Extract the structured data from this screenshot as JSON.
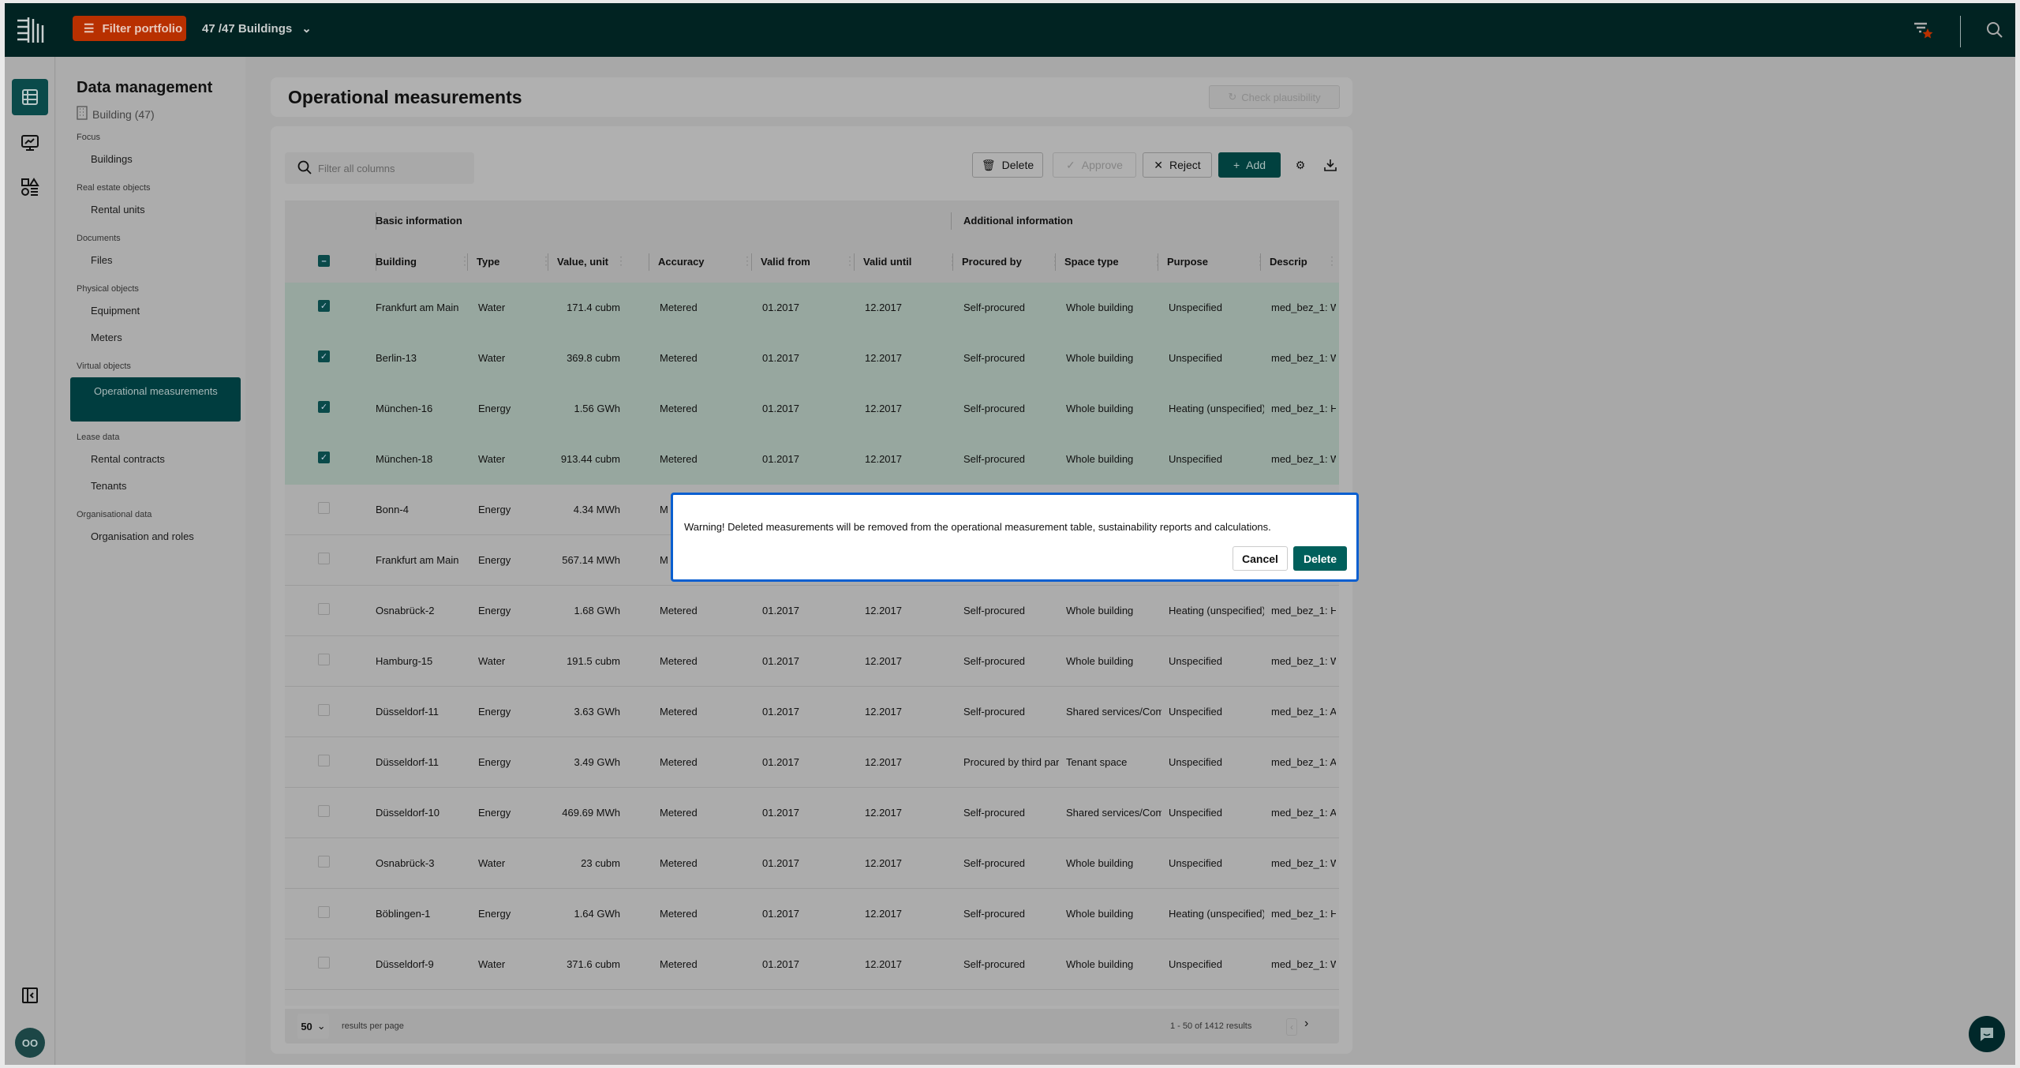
{
  "topbar": {
    "filter_label": "Filter portfolio",
    "buildings_selector": "47 /47 Buildings"
  },
  "sidebar": {
    "title": "Data management",
    "subtitle": "Building (47)",
    "sections": [
      {
        "label": "Focus",
        "items": [
          "Buildings"
        ]
      },
      {
        "label": "Real estate objects",
        "items": [
          "Rental units"
        ]
      },
      {
        "label": "Documents",
        "items": [
          "Files"
        ]
      },
      {
        "label": "Physical objects",
        "items": [
          "Equipment",
          "Meters"
        ]
      },
      {
        "label": "Virtual objects",
        "items": [
          "Operational measurements"
        ]
      },
      {
        "label": "Lease data",
        "items": [
          "Rental contracts",
          "Tenants"
        ]
      },
      {
        "label": "Organisational data",
        "items": [
          "Organisation and roles"
        ]
      }
    ],
    "active_item": "Operational measurements",
    "avatar_initials": "OO"
  },
  "page": {
    "title": "Operational measurements",
    "check_plausibility": "Check plausibility"
  },
  "toolbar": {
    "search_placeholder": "Filter all columns",
    "delete": "Delete",
    "approve": "Approve",
    "reject": "Reject",
    "add": "Add"
  },
  "table": {
    "groups": [
      "Basic information",
      "Additional information"
    ],
    "columns": [
      "Building",
      "Type",
      "Value, unit",
      "Accuracy",
      "Valid from",
      "Valid until",
      "Procured by",
      "Space type",
      "Purpose",
      "Descrip"
    ],
    "rows": [
      {
        "selected": true,
        "cells": [
          "Frankfurt am Main",
          "Water",
          "171.4 cubm",
          "Metered",
          "01.2017",
          "12.2017",
          "Self-procured",
          "Whole building",
          "Unspecified",
          "med_bez_1: W"
        ]
      },
      {
        "selected": true,
        "cells": [
          "Berlin-13",
          "Water",
          "369.8 cubm",
          "Metered",
          "01.2017",
          "12.2017",
          "Self-procured",
          "Whole building",
          "Unspecified",
          "med_bez_1: W"
        ]
      },
      {
        "selected": true,
        "cells": [
          "München-16",
          "Energy",
          "1.56 GWh",
          "Metered",
          "01.2017",
          "12.2017",
          "Self-procured",
          "Whole building",
          "Heating (unspecified)",
          "med_bez_1: H"
        ]
      },
      {
        "selected": true,
        "cells": [
          "München-18",
          "Water",
          "913.44 cubm",
          "Metered",
          "01.2017",
          "12.2017",
          "Self-procured",
          "Whole building",
          "Unspecified",
          "med_bez_1: W"
        ]
      },
      {
        "selected": false,
        "cells": [
          "Bonn-4",
          "Energy",
          "4.34 MWh",
          "M",
          "",
          "",
          "",
          "",
          "",
          ""
        ]
      },
      {
        "selected": false,
        "cells": [
          "Frankfurt am Main",
          "Energy",
          "567.14 MWh",
          "M",
          "",
          "",
          "",
          "",
          "",
          ""
        ]
      },
      {
        "selected": false,
        "cells": [
          "Osnabrück-2",
          "Energy",
          "1.68 GWh",
          "Metered",
          "01.2017",
          "12.2017",
          "Self-procured",
          "Whole building",
          "Heating (unspecified)",
          "med_bez_1: H"
        ]
      },
      {
        "selected": false,
        "cells": [
          "Hamburg-15",
          "Water",
          "191.5 cubm",
          "Metered",
          "01.2017",
          "12.2017",
          "Self-procured",
          "Whole building",
          "Unspecified",
          "med_bez_1: W"
        ]
      },
      {
        "selected": false,
        "cells": [
          "Düsseldorf-11",
          "Energy",
          "3.63 GWh",
          "Metered",
          "01.2017",
          "12.2017",
          "Self-procured",
          "Shared services/Common areas",
          "Unspecified",
          "med_bez_1: A"
        ]
      },
      {
        "selected": false,
        "cells": [
          "Düsseldorf-11",
          "Energy",
          "3.49 GWh",
          "Metered",
          "01.2017",
          "12.2017",
          "Procured by third party",
          "Tenant space",
          "Unspecified",
          "med_bez_1: A"
        ]
      },
      {
        "selected": false,
        "cells": [
          "Düsseldorf-10",
          "Energy",
          "469.69 MWh",
          "Metered",
          "01.2017",
          "12.2017",
          "Self-procured",
          "Shared services/Common areas",
          "Unspecified",
          "med_bez_1: A"
        ]
      },
      {
        "selected": false,
        "cells": [
          "Osnabrück-3",
          "Water",
          "23 cubm",
          "Metered",
          "01.2017",
          "12.2017",
          "Self-procured",
          "Whole building",
          "Unspecified",
          "med_bez_1: W"
        ]
      },
      {
        "selected": false,
        "cells": [
          "Böblingen-1",
          "Energy",
          "1.64 GWh",
          "Metered",
          "01.2017",
          "12.2017",
          "Self-procured",
          "Whole building",
          "Heating (unspecified)",
          "med_bez_1: H"
        ]
      },
      {
        "selected": false,
        "cells": [
          "Düsseldorf-9",
          "Water",
          "371.6 cubm",
          "Metered",
          "01.2017",
          "12.2017",
          "Self-procured",
          "Whole building",
          "Unspecified",
          "med_bez_1: W"
        ]
      }
    ]
  },
  "pagination": {
    "per_page": "50",
    "per_page_label": "results per page",
    "range": "1 - 50 of  1412 results"
  },
  "modal": {
    "message": "Warning! Deleted measurements will be removed from the operational measurement table, sustainability reports and calculations.",
    "cancel": "Cancel",
    "delete": "Delete"
  },
  "colors": {
    "topbar": "#012322",
    "filter_button": "#b83000",
    "accent": "#005f5b",
    "modal_border": "#0a5fd0"
  }
}
